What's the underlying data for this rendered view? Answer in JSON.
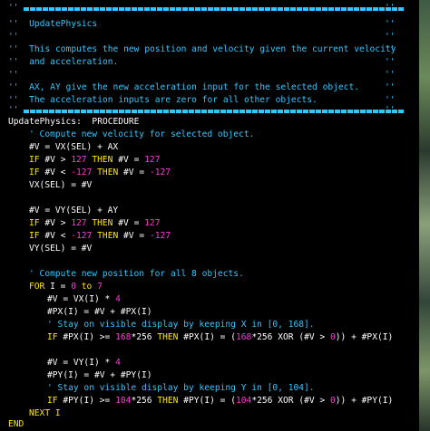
{
  "code": {
    "header_title": "UpdatePhysics",
    "header_line1": "This computes the new position and velocity given the current velocity",
    "header_line2": "and acceleration.",
    "header_line3": "AX, AY give the new acceleration input for the selected object.",
    "header_line4": "The acceleration inputs are zero for all other objects.",
    "proc_decl": "UpdatePhysics:  PROCEDURE",
    "cm_velocity": "' Compute new velocity for selected object.",
    "vx_assign": "#V = VX(SEL) + AX",
    "kw_if": "IF",
    "kw_then": "THEN",
    "v_var": "#V",
    "gt": ">",
    "lt": "<",
    "eq": "=",
    "num_127": "127",
    "num_neg127": "-127",
    "vx_store": "VX(SEL) = #V",
    "vy_assign": "#V = VY(SEL) + AY",
    "vy_store": "VY(SEL) = #V",
    "cm_position": "' Compute new position for all 8 objects.",
    "kw_for": "FOR",
    "for_var": "I =",
    "num_0": "0",
    "kw_to": "to",
    "num_7": "7",
    "vxi_assign": "#V = VX(I) *",
    "num_4": "4",
    "pxi_assign": "#PX(I) = #V + #PX(I)",
    "cm_stay_x": "' Stay on visible display by keeping X in [0, 168].",
    "pxi": "#PX(I)",
    "ge": ">=",
    "num_168": "168",
    "mul_256": "*256",
    "px_then_lhs": "#PX(I) = (",
    "xor_part": "XOR (#V >",
    "close_paren": ")) + #PX(I)",
    "vyi_assign": "#V = VY(I) *",
    "pyi_assign": "#PY(I) = #V + #PY(I)",
    "cm_stay_y": "' Stay on visible display by keeping Y in [0, 104].",
    "pyi": "#PY(I)",
    "num_104": "104",
    "py_then_lhs": "#PY(I) = (",
    "close_paren_y": ")) + #PY(I)",
    "next_i": "NEXT I",
    "end": "END"
  },
  "colors": {
    "text": "#ffffff",
    "comment": "#33c6ff",
    "keyword": "#ffe600",
    "number": "#ff3bd8",
    "background": "#000000"
  }
}
